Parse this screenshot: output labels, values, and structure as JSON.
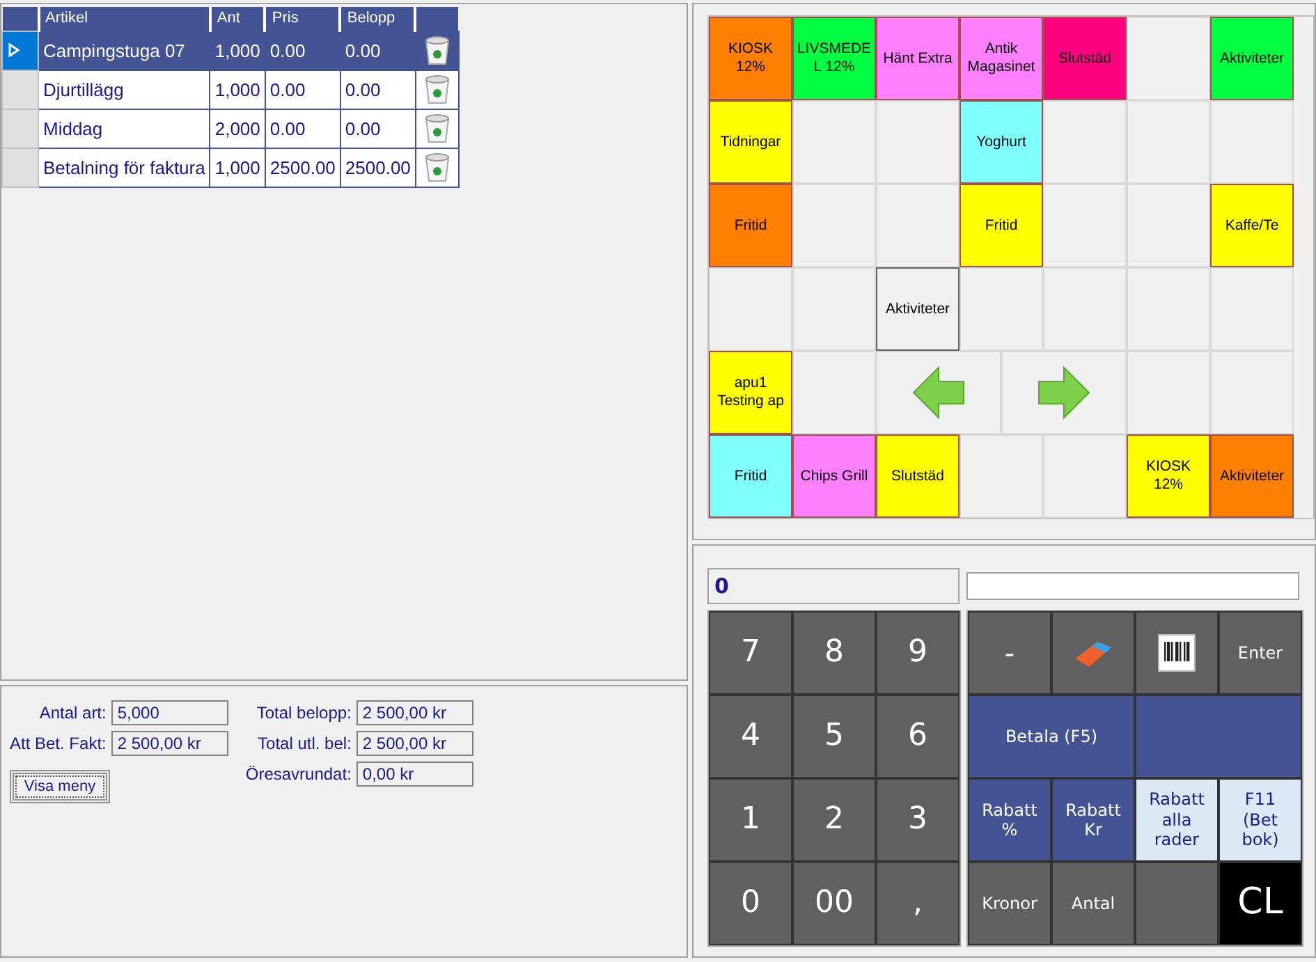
{
  "table": {
    "columns": [
      "Artikel",
      "Ant",
      "Pris",
      "Belopp"
    ],
    "rows": [
      {
        "cells": [
          "Campingstuga 07",
          "1,000",
          "0.00",
          "0.00"
        ],
        "selected": true
      },
      {
        "cells": [
          "Djurtillägg",
          "1,000",
          "0.00",
          "0.00"
        ],
        "selected": false
      },
      {
        "cells": [
          "Middag",
          "2,000",
          "0.00",
          "0.00"
        ],
        "selected": false
      },
      {
        "cells": [
          "Betalning för faktura",
          "1,000",
          "2500.00",
          "2500.00"
        ],
        "selected": false
      }
    ]
  },
  "summary": {
    "left": [
      {
        "label": "Antal art:",
        "value": "5,000"
      },
      {
        "label": "Att Bet. Fakt:",
        "value": "2 500,00 kr"
      }
    ],
    "right": [
      {
        "label": "Total belopp:",
        "value": "2 500,00 kr"
      },
      {
        "label": "Total utl. bel:",
        "value": "2 500,00 kr"
      },
      {
        "label": "Öresavrundat:",
        "value": "0,00 kr"
      }
    ],
    "menu_button": "Visa meny"
  },
  "product_grid": [
    [
      {
        "kind": "tile",
        "label": "KIOSK 12%",
        "color": "#ff8000"
      },
      {
        "kind": "tile",
        "label": "LIVSMEDE L 12%",
        "color": "#00ff40"
      },
      {
        "kind": "tile",
        "label": "Hänt Extra",
        "color": "#ff80ff"
      },
      {
        "kind": "tile",
        "label": "Antik Magasinet",
        "color": "#ff80ff"
      },
      {
        "kind": "tile",
        "label": "Slutstäd",
        "color": "#ff0080"
      },
      {
        "kind": "blank"
      },
      {
        "kind": "tile",
        "label": "Aktiviteter",
        "color": "#00ff40"
      }
    ],
    [
      {
        "kind": "tile",
        "label": "Tidningar",
        "color": "#ffff00"
      },
      {
        "kind": "blank"
      },
      {
        "kind": "blank"
      },
      {
        "kind": "tile",
        "label": "Yoghurt",
        "color": "#80ffff"
      },
      {
        "kind": "blank"
      },
      {
        "kind": "blank"
      },
      {
        "kind": "blank"
      }
    ],
    [
      {
        "kind": "tile",
        "label": "Fritid",
        "color": "#ff8000"
      },
      {
        "kind": "blank"
      },
      {
        "kind": "blank"
      },
      {
        "kind": "tile",
        "label": "Fritid",
        "color": "#ffff00"
      },
      {
        "kind": "blank"
      },
      {
        "kind": "blank"
      },
      {
        "kind": "tile",
        "label": "Kaffe/Te",
        "color": "#ffff00"
      }
    ],
    [
      {
        "kind": "blank"
      },
      {
        "kind": "blank"
      },
      {
        "kind": "framed",
        "label": "Aktiviteter",
        "color": "#f0f0f0"
      },
      {
        "kind": "blank"
      },
      {
        "kind": "blank"
      },
      {
        "kind": "blank"
      },
      {
        "kind": "blank"
      }
    ],
    [
      {
        "kind": "tile",
        "label": "apu1 Testing ap",
        "color": "#ffff00"
      },
      {
        "kind": "blank"
      },
      {
        "kind": "prev"
      },
      {
        "kind": "next"
      },
      {
        "kind": "blank"
      },
      {
        "kind": "blank"
      }
    ],
    [
      {
        "kind": "tile",
        "label": "Fritid",
        "color": "#80ffff"
      },
      {
        "kind": "tile",
        "label": "Chips Grill",
        "color": "#ff80ff"
      },
      {
        "kind": "tile",
        "label": "Slutstäd",
        "color": "#ffff00"
      },
      {
        "kind": "blank"
      },
      {
        "kind": "blank"
      },
      {
        "kind": "tile",
        "label": "KIOSK 12%",
        "color": "#ffff00"
      },
      {
        "kind": "tile",
        "label": "Aktiviteter",
        "color": "#ff8000"
      }
    ]
  ],
  "entry": {
    "value": "0"
  },
  "numpad": [
    "7",
    "8",
    "9",
    "4",
    "5",
    "6",
    "1",
    "2",
    "3",
    "0",
    "00",
    ","
  ],
  "function_keys": [
    {
      "kind": "key",
      "label": "-",
      "color": "#606060"
    },
    {
      "kind": "eraser",
      "color": "#606060"
    },
    {
      "kind": "barcode",
      "color": "#606060"
    },
    {
      "kind": "key",
      "label": "Enter",
      "color": "#606060"
    },
    {
      "kind": "wide",
      "label": "Betala (F5)",
      "color": "#435393"
    },
    {
      "kind": "wide-blank",
      "color": "#435393"
    },
    {
      "kind": "key",
      "label": "Rabatt %",
      "color": "#435393"
    },
    {
      "kind": "key",
      "label": "Rabatt Kr",
      "color": "#435393"
    },
    {
      "kind": "key",
      "label": "Rabatt alla rader",
      "color": "#dce8f4"
    },
    {
      "kind": "key",
      "label": "F11 (Bet bok)",
      "color": "#dce8f4"
    },
    {
      "kind": "key",
      "label": "Kronor",
      "color": "#606060"
    },
    {
      "kind": "key",
      "label": "Antal",
      "color": "#606060"
    },
    {
      "kind": "blank",
      "color": "#606060"
    },
    {
      "kind": "big",
      "label": "CL",
      "color": "#000000"
    }
  ]
}
